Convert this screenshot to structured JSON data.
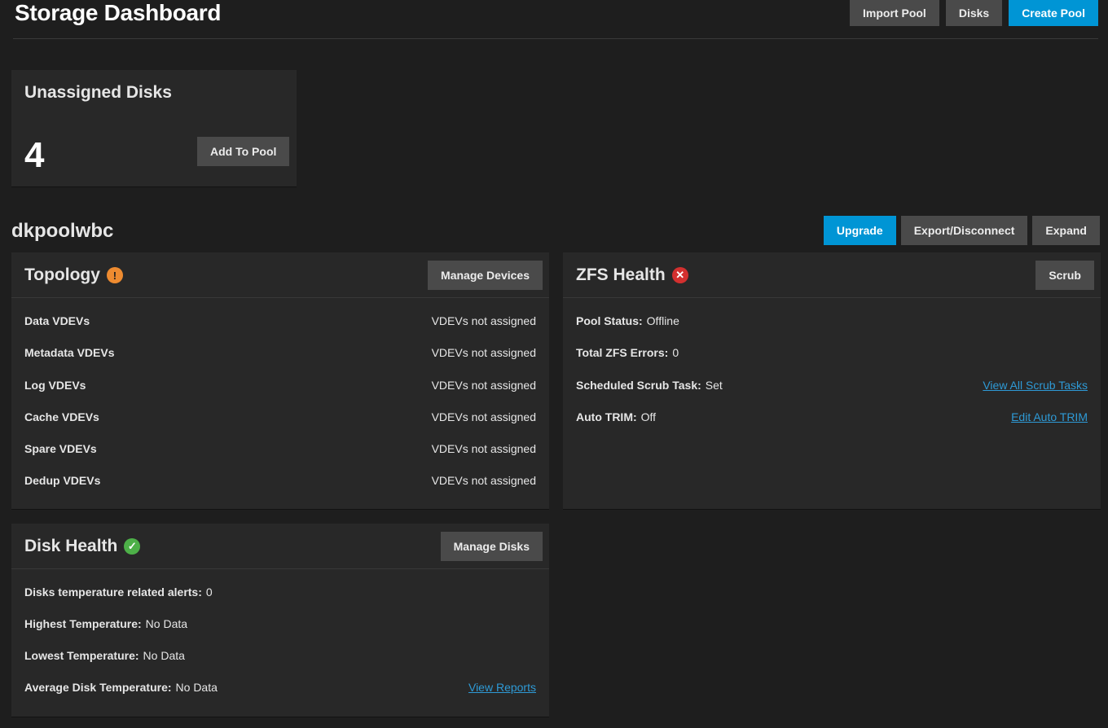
{
  "header": {
    "title": "Storage Dashboard",
    "actions": {
      "import_pool": "Import Pool",
      "disks": "Disks",
      "create_pool": "Create Pool"
    }
  },
  "unassigned": {
    "title": "Unassigned Disks",
    "count": "4",
    "add_button": "Add To Pool"
  },
  "pool": {
    "name": "dkpoolwbc",
    "actions": {
      "upgrade": "Upgrade",
      "export": "Export/Disconnect",
      "expand": "Expand"
    }
  },
  "topology": {
    "title": "Topology",
    "status_icon": "warning-icon",
    "manage_button": "Manage Devices",
    "rows": [
      {
        "label": "Data VDEVs",
        "value": "VDEVs not assigned"
      },
      {
        "label": "Metadata VDEVs",
        "value": "VDEVs not assigned"
      },
      {
        "label": "Log VDEVs",
        "value": "VDEVs not assigned"
      },
      {
        "label": "Cache VDEVs",
        "value": "VDEVs not assigned"
      },
      {
        "label": "Spare VDEVs",
        "value": "VDEVs not assigned"
      },
      {
        "label": "Dedup VDEVs",
        "value": "VDEVs not assigned"
      }
    ]
  },
  "zfs": {
    "title": "ZFS Health",
    "status_icon": "error-icon",
    "scrub_button": "Scrub",
    "pool_status_label": "Pool Status:",
    "pool_status_value": "Offline",
    "errors_label": "Total ZFS Errors:",
    "errors_value": "0",
    "scrub_task_label": "Scheduled Scrub Task:",
    "scrub_task_value": "Set",
    "scrub_link": "View All Scrub Tasks",
    "trim_label": "Auto TRIM:",
    "trim_value": "Off",
    "trim_link": "Edit Auto TRIM"
  },
  "disk_health": {
    "title": "Disk Health",
    "status_icon": "check-icon",
    "manage_button": "Manage Disks",
    "alerts_label": "Disks temperature related alerts:",
    "alerts_value": "0",
    "highest_label": "Highest Temperature:",
    "highest_value": "No Data",
    "lowest_label": "Lowest Temperature:",
    "lowest_value": "No Data",
    "average_label": "Average Disk Temperature:",
    "average_value": "No Data",
    "reports_link": "View Reports"
  },
  "colors": {
    "primary": "#0095d5",
    "warning": "#ee8b30",
    "error": "#d3302f",
    "success": "#4db048",
    "link": "#2e9ad6"
  }
}
